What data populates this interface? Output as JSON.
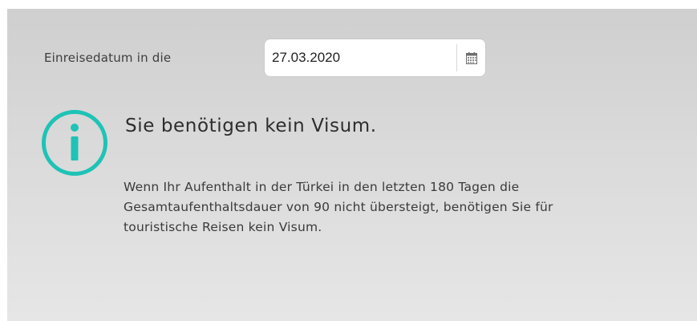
{
  "entry_date": {
    "label": "Einreisedatum in die",
    "value": "27.03.2020",
    "calendar_icon": "calendar-icon"
  },
  "result": {
    "icon": "info-icon",
    "icon_color": "#1ec3b6",
    "title": "Sie benötigen kein Visum.",
    "text_lines": [
      "Wenn Ihr Aufenthalt in der Türkei in den letzten 180 Tagen die",
      "Gesamtaufenthaltsdauer von 90 nicht übersteigt, benötigen Sie für",
      "touristische Reisen kein Visum."
    ]
  }
}
